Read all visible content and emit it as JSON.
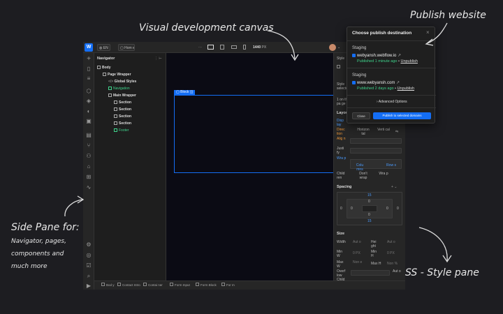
{
  "annotations": {
    "canvas": "Visual development canvas",
    "publish": "Publish website",
    "side_title": "Side Pane for:",
    "side_lines": [
      "Navigator, pages,",
      "components and",
      "much more"
    ],
    "css": "CSS - Style pane"
  },
  "topbar": {
    "locale": "EN",
    "page": "Hom e",
    "dots": "⋯",
    "width": "1440",
    "width_unit": "PX"
  },
  "navigator": {
    "title": "Navigator",
    "items": [
      {
        "label": "Body"
      },
      {
        "label": "Page Wrapper"
      },
      {
        "label": "Global Styles"
      },
      {
        "label": "Navigation"
      },
      {
        "label": "Main Wrapper"
      },
      {
        "label": "Section"
      },
      {
        "label": "Section"
      },
      {
        "label": "Section"
      },
      {
        "label": "Section"
      },
      {
        "label": "Footer"
      }
    ]
  },
  "canvas": {
    "selected_tag": "Block"
  },
  "style_pane": {
    "labels": {
      "style": "Style",
      "style_sel": "Style selecto",
      "on_this": "1 on this pa ge",
      "layout": "Layout",
      "display": "Disp lay",
      "direction": "Direc tion",
      "align": "Alig n",
      "justify": "Justi fy",
      "wrap": "Wra p",
      "children": "Child ren",
      "spacing": "Spacing",
      "size": "Size",
      "width": "Width",
      "height": "Hei ght",
      "min_w": "Min W",
      "min_h": "Min H",
      "max_w": "Max W",
      "max_h": "Max H",
      "overflow": "Overf low",
      "child2": "Child"
    },
    "layout_options": {
      "horizontal": "Horizon tal",
      "vertical": "Verti cal",
      "columns": "Colu mns",
      "rows": "Row s",
      "dont_wrap": "Don't wrap",
      "wrap_opt": "Wra p"
    },
    "spacing": {
      "margin_top": "15",
      "margin_bottom": "15",
      "pad_left": "0",
      "pad_right": "0",
      "pad_top": "0",
      "pad_bottom": "0",
      "m_left": "0",
      "m_right": "0"
    },
    "size": {
      "width_val": "Aut o",
      "height_val": "Aut o",
      "minw_val": "0",
      "minh_val": "0",
      "maxw_val": "Non e",
      "maxh_val": "Non",
      "auto2": "Aut o",
      "px": "PX",
      "pct": "%"
    }
  },
  "publish": {
    "title": "Choose publish destination",
    "close": "×",
    "staging1": "Staging",
    "site1": "webyansh.webflow.io",
    "status1": "Published 1 minute ago",
    "action1": "Unpublish",
    "staging2": "Staging",
    "site2": "www.webyansh.com",
    "status2": "Published 2 days ago",
    "action2": "Unpublish",
    "advanced": "Advanced Options",
    "close_btn": "Close",
    "publish_btn": "Publish to selected domains"
  },
  "bottombar": {
    "items": [
      "Bod y",
      "Contact Intro",
      "Contai ner",
      "Form Input",
      "Form Block",
      "For m"
    ]
  },
  "colors": {
    "accent": "#146ef5",
    "green": "#3fd48c",
    "canvas": "#0b0b14",
    "orange": "#e8943a"
  }
}
